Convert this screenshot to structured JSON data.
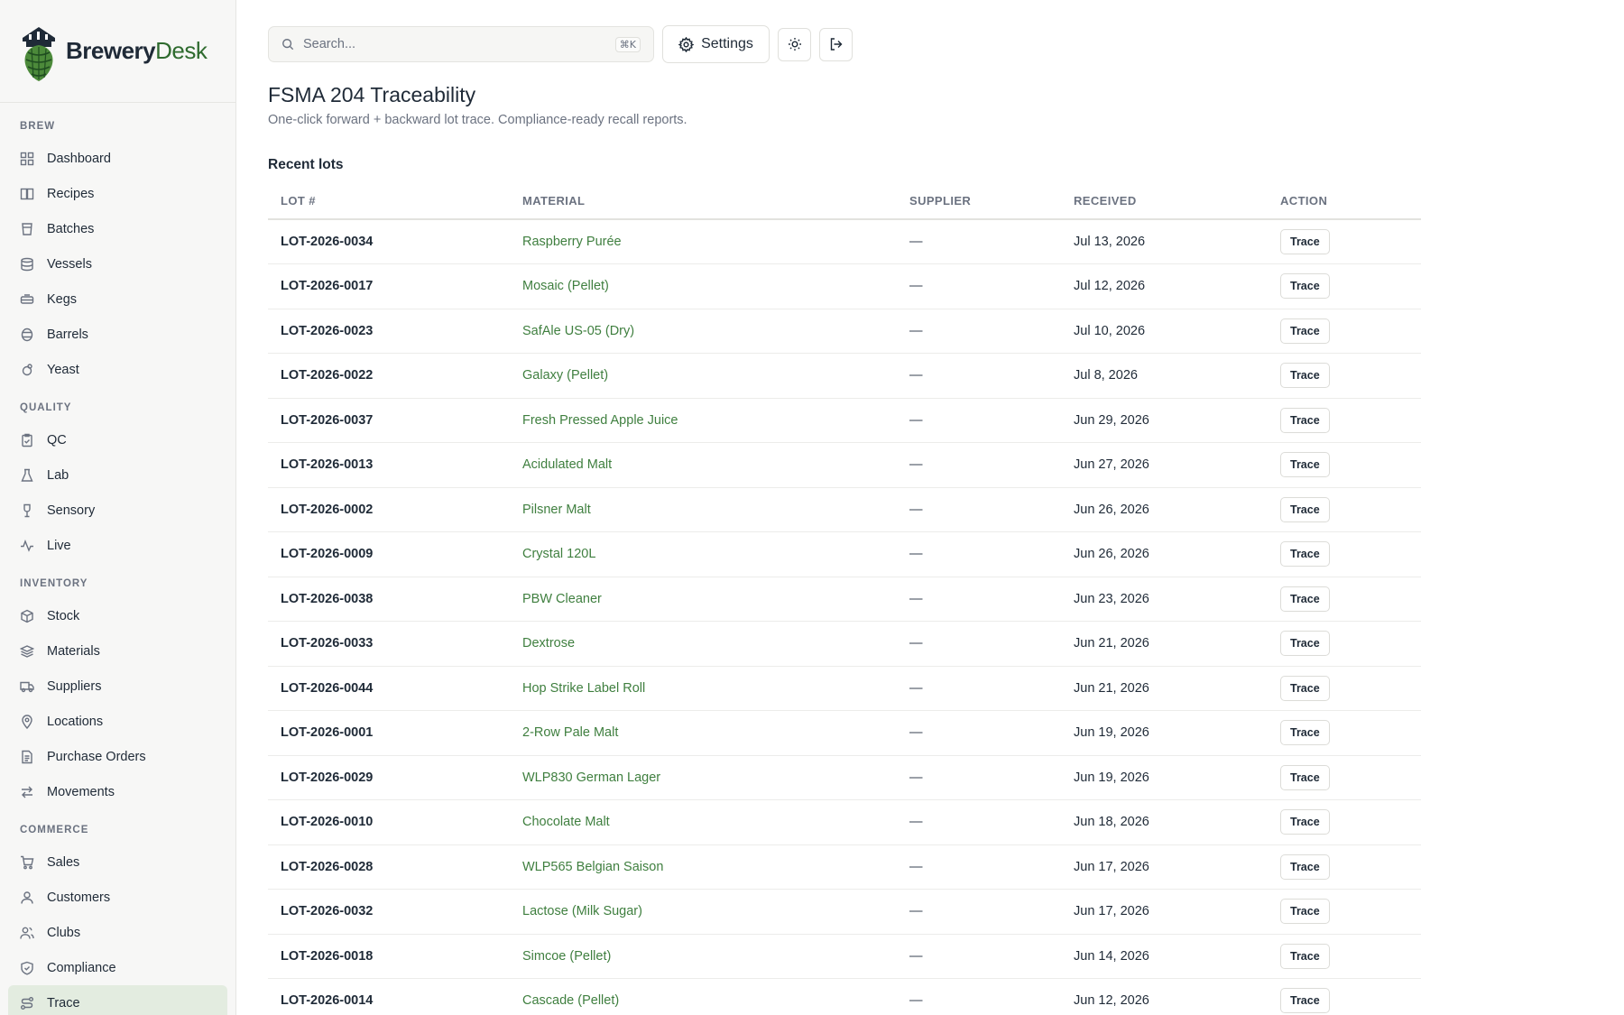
{
  "brand": {
    "name_part1": "Brewery",
    "name_part2": "Desk"
  },
  "sidebar": {
    "sections": [
      {
        "heading": "BREW",
        "items": [
          {
            "label": "Dashboard",
            "icon": "grid-icon"
          },
          {
            "label": "Recipes",
            "icon": "book-icon"
          },
          {
            "label": "Batches",
            "icon": "beaker-icon"
          },
          {
            "label": "Vessels",
            "icon": "database-icon"
          },
          {
            "label": "Kegs",
            "icon": "keg-icon"
          },
          {
            "label": "Barrels",
            "icon": "barrel-icon"
          },
          {
            "label": "Yeast",
            "icon": "yeast-icon"
          }
        ]
      },
      {
        "heading": "QUALITY",
        "items": [
          {
            "label": "QC",
            "icon": "clipboard-check-icon"
          },
          {
            "label": "Lab",
            "icon": "flask-icon"
          },
          {
            "label": "Sensory",
            "icon": "wine-glass-icon"
          },
          {
            "label": "Live",
            "icon": "activity-icon"
          }
        ]
      },
      {
        "heading": "INVENTORY",
        "items": [
          {
            "label": "Stock",
            "icon": "box-icon"
          },
          {
            "label": "Materials",
            "icon": "layers-icon"
          },
          {
            "label": "Suppliers",
            "icon": "truck-icon"
          },
          {
            "label": "Locations",
            "icon": "map-pin-icon"
          },
          {
            "label": "Purchase Orders",
            "icon": "file-icon"
          },
          {
            "label": "Movements",
            "icon": "arrows-icon"
          }
        ]
      },
      {
        "heading": "COMMERCE",
        "items": [
          {
            "label": "Sales",
            "icon": "cart-icon"
          },
          {
            "label": "Customers",
            "icon": "user-icon"
          },
          {
            "label": "Clubs",
            "icon": "users-icon"
          },
          {
            "label": "Compliance",
            "icon": "shield-icon"
          },
          {
            "label": "Trace",
            "icon": "route-icon",
            "active": true
          }
        ]
      }
    ]
  },
  "topbar": {
    "search_placeholder": "Search...",
    "search_shortcut": "⌘K",
    "settings_label": "Settings"
  },
  "page": {
    "title": "FSMA 204 Traceability",
    "subtitle": "One-click forward + backward lot trace. Compliance-ready recall reports.",
    "section_title": "Recent lots"
  },
  "table": {
    "headers": [
      "LOT #",
      "MATERIAL",
      "SUPPLIER",
      "RECEIVED",
      "ACTION"
    ],
    "action_label": "Trace",
    "rows": [
      {
        "lot": "LOT-2026-0034",
        "material": "Raspberry Purée",
        "supplier": "—",
        "received": "Jul 13, 2026"
      },
      {
        "lot": "LOT-2026-0017",
        "material": "Mosaic (Pellet)",
        "supplier": "—",
        "received": "Jul 12, 2026"
      },
      {
        "lot": "LOT-2026-0023",
        "material": "SafAle US-05 (Dry)",
        "supplier": "—",
        "received": "Jul 10, 2026"
      },
      {
        "lot": "LOT-2026-0022",
        "material": "Galaxy (Pellet)",
        "supplier": "—",
        "received": "Jul 8, 2026"
      },
      {
        "lot": "LOT-2026-0037",
        "material": "Fresh Pressed Apple Juice",
        "supplier": "—",
        "received": "Jun 29, 2026"
      },
      {
        "lot": "LOT-2026-0013",
        "material": "Acidulated Malt",
        "supplier": "—",
        "received": "Jun 27, 2026"
      },
      {
        "lot": "LOT-2026-0002",
        "material": "Pilsner Malt",
        "supplier": "—",
        "received": "Jun 26, 2026"
      },
      {
        "lot": "LOT-2026-0009",
        "material": "Crystal 120L",
        "supplier": "—",
        "received": "Jun 26, 2026"
      },
      {
        "lot": "LOT-2026-0038",
        "material": "PBW Cleaner",
        "supplier": "—",
        "received": "Jun 23, 2026"
      },
      {
        "lot": "LOT-2026-0033",
        "material": "Dextrose",
        "supplier": "—",
        "received": "Jun 21, 2026"
      },
      {
        "lot": "LOT-2026-0044",
        "material": "Hop Strike Label Roll",
        "supplier": "—",
        "received": "Jun 21, 2026"
      },
      {
        "lot": "LOT-2026-0001",
        "material": "2-Row Pale Malt",
        "supplier": "—",
        "received": "Jun 19, 2026"
      },
      {
        "lot": "LOT-2026-0029",
        "material": "WLP830 German Lager",
        "supplier": "—",
        "received": "Jun 19, 2026"
      },
      {
        "lot": "LOT-2026-0010",
        "material": "Chocolate Malt",
        "supplier": "—",
        "received": "Jun 18, 2026"
      },
      {
        "lot": "LOT-2026-0028",
        "material": "WLP565 Belgian Saison",
        "supplier": "—",
        "received": "Jun 17, 2026"
      },
      {
        "lot": "LOT-2026-0032",
        "material": "Lactose (Milk Sugar)",
        "supplier": "—",
        "received": "Jun 17, 2026"
      },
      {
        "lot": "LOT-2026-0018",
        "material": "Simcoe (Pellet)",
        "supplier": "—",
        "received": "Jun 14, 2026"
      },
      {
        "lot": "LOT-2026-0014",
        "material": "Cascade (Pellet)",
        "supplier": "—",
        "received": "Jun 12, 2026"
      }
    ]
  },
  "colors": {
    "accent_green": "#3f7f3f",
    "active_nav_bg": "#e3ece0",
    "sidebar_bg": "#f7f7f6"
  }
}
